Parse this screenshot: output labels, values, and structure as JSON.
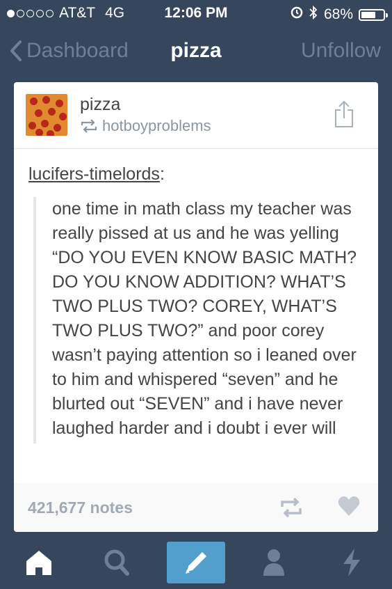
{
  "status_bar": {
    "carrier": "AT&T",
    "network": "4G",
    "time": "12:06 PM",
    "battery_percent": "68%",
    "battery_level": 0.68,
    "signal_bars": 1
  },
  "nav": {
    "back_label": "Dashboard",
    "title": "pizza",
    "unfollow_label": "Unfollow"
  },
  "post": {
    "blog_name": "pizza",
    "reblogged_from": "hotboyproblems",
    "source_user": "lucifers-timelords",
    "source_suffix": ":",
    "quote_text": "one time in math class my teacher was really pissed at us and he was yelling “DO YOU EVEN KNOW BASIC MATH? DO YOU KNOW ADDITION? WHAT’S TWO PLUS TWO? COREY, WHAT’S TWO PLUS TWO?” and poor corey wasn’t paying attention so i leaned over to him and whispered “seven” and he blurted out “SEVEN” and i have never laughed harder and i doubt i ever will",
    "notes": "421,677 notes"
  },
  "tab_bar": {
    "items": [
      "home-icon",
      "search-icon",
      "compose-icon",
      "account-icon",
      "activity-icon"
    ]
  },
  "colors": {
    "background": "#36465d",
    "accent": "#529ecc",
    "muted_nav": "#6f7f94"
  }
}
